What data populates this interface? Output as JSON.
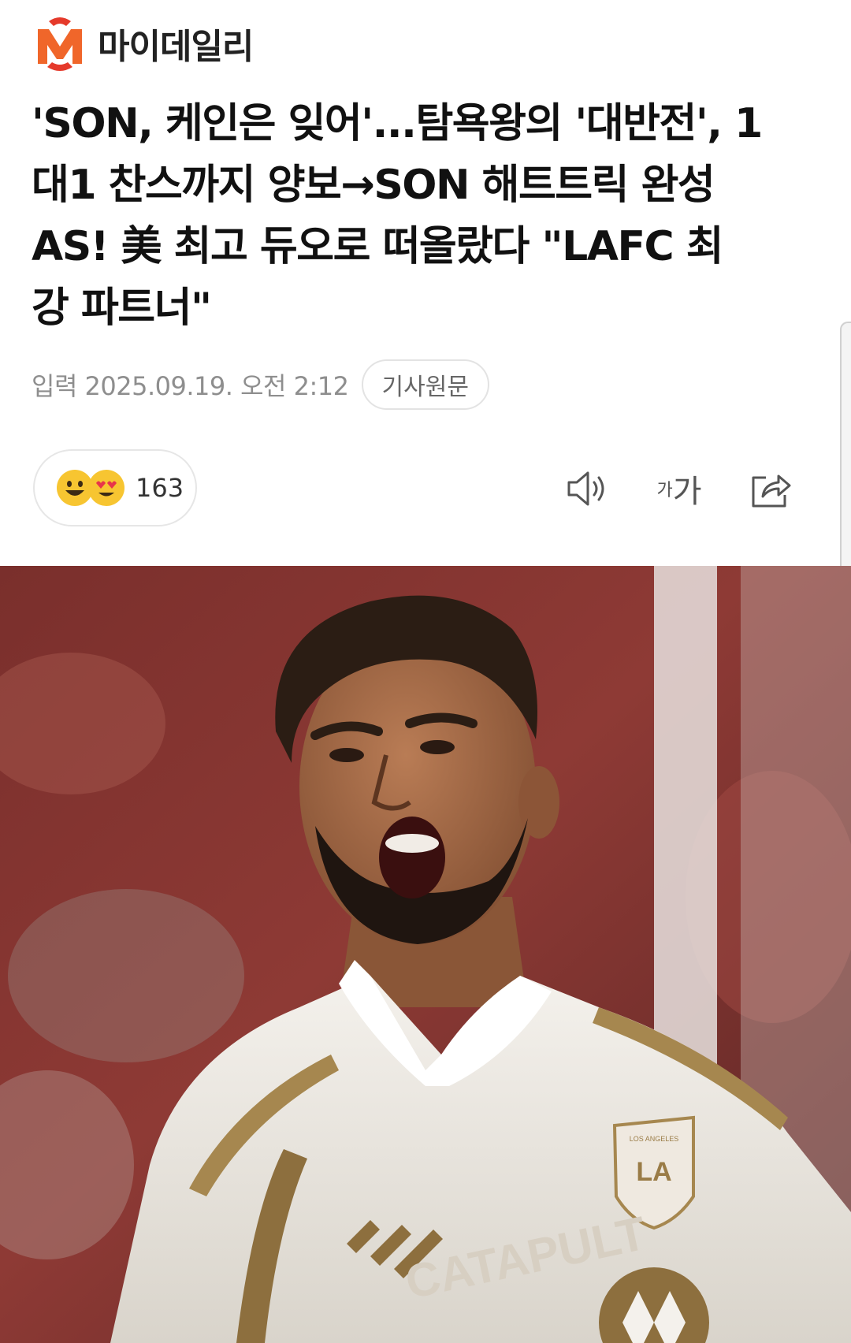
{
  "brand": {
    "name": "마이데일리",
    "logo_icon": "mydaily-logo-icon",
    "colors": {
      "orange": "#f0662a",
      "red": "#e53a2b"
    }
  },
  "article": {
    "headline_lines": [
      "'SON, 케인은 잊어'...탐욕왕의 '대반전', 1",
      "대1 찬스까지 양보→SON 해트트릭 완성",
      "AS! 美 최고 듀오로 떠올랐다 \"LAFC 최",
      "강 파트너\""
    ],
    "date": "입력 2025.09.19. 오전 2:12",
    "source_button": "기사원문"
  },
  "reactions": {
    "emojis": [
      "smile-emoji-icon",
      "heart-eyes-emoji-icon"
    ],
    "count": "163"
  },
  "tools": {
    "tts_icon": "speaker-icon",
    "font_size_small": "가",
    "font_size_large": "가",
    "share_icon": "share-icon"
  },
  "photo": {
    "description_icon": "article-photo",
    "jersey_text": "CATAPULT",
    "badge_text": "LOS ANGELES"
  }
}
